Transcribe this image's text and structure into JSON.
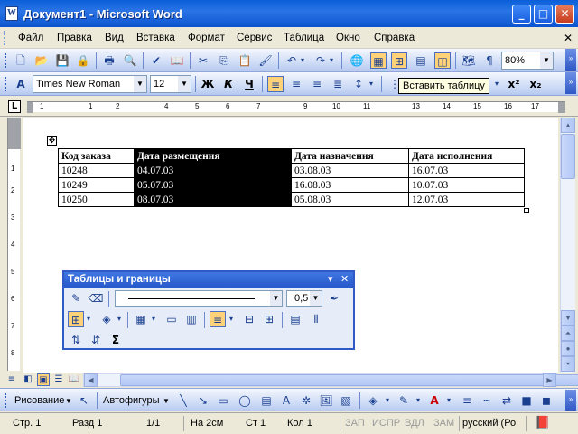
{
  "window": {
    "title": "Документ1 - Microsoft Word",
    "app_icon_letter": "W",
    "minimize": "_",
    "maximize": "□",
    "close": "✕"
  },
  "menu": {
    "items": [
      "Файл",
      "Правка",
      "Вид",
      "Вставка",
      "Формат",
      "Сервис",
      "Таблица",
      "Окно",
      "Справка"
    ],
    "doc_close": "✕"
  },
  "standard_toolbar": {
    "zoom": "80%",
    "tooltip": "Вставить таблицу"
  },
  "formatting_toolbar": {
    "font_name": "Times New Roman",
    "font_size": "12",
    "bold": "Ж",
    "italic": "К",
    "underline": "Ч"
  },
  "ruler": {
    "corner": "L",
    "numbers": [
      "1",
      "1",
      "2",
      "3",
      "4",
      "5",
      "6",
      "7",
      "8",
      "9",
      "10",
      "11",
      "12",
      "13",
      "14",
      "15",
      "16",
      "17"
    ],
    "vnumbers": [
      "1",
      "1",
      "2",
      "3",
      "4",
      "5",
      "6",
      "7",
      "8",
      "9"
    ]
  },
  "document": {
    "table": {
      "headers": [
        "Код заказа",
        "Дата размещения",
        "Дата назначения",
        "Дата исполнения"
      ],
      "rows": [
        [
          "10248",
          "04.07.03",
          "03.08.03",
          "16.07.03"
        ],
        [
          "10249",
          "05.07.03",
          "16.08.03",
          "10.07.03"
        ],
        [
          "10250",
          "08.07.03",
          "05.08.03",
          "12.07.03"
        ]
      ]
    }
  },
  "tables_panel": {
    "title": "Таблицы и границы",
    "line_weight": "0,5",
    "sum_symbol": "Σ"
  },
  "drawing_toolbar": {
    "draw_label": "Рисование",
    "autoshapes_label": "Автофигуры"
  },
  "status_bar": {
    "page": "Стр. 1",
    "section": "Разд 1",
    "pages": "1/1",
    "at": "На 2см",
    "line": "Ст 1",
    "column": "Кол 1",
    "rec": "ЗАП",
    "trk": "ИСПР",
    "ext": "ВДЛ",
    "ovr": "ЗАМ",
    "language": "русский (Ро"
  },
  "colors": {
    "title_bar": "#0a5fd8",
    "toolbar": "#c9d8f5",
    "selection": "#000000",
    "tooltip": "#ffffe1",
    "active_button": "#ffd27a"
  }
}
